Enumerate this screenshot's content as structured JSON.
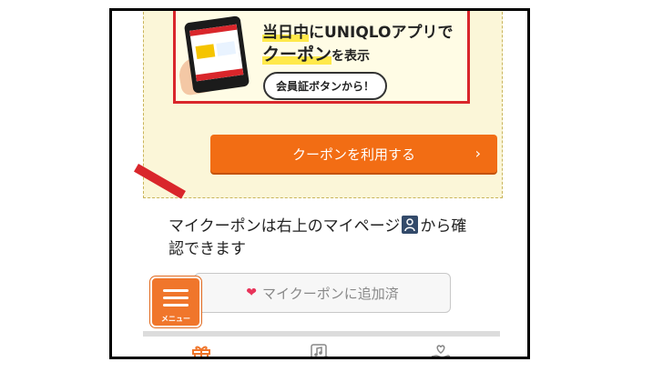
{
  "promo": {
    "line1_highlight": "当日中",
    "line1_rest": "にUNIQLOアプリで",
    "line2_highlight": "クーポン",
    "line2_rest": "を表示",
    "bubble": "会員証ボタンから！"
  },
  "use_button": {
    "label": "クーポンを利用する"
  },
  "info": {
    "text_before": "マイクーポンは右上のマイページ",
    "text_after": "から確認できます"
  },
  "added_button": {
    "label": "マイクーポンに追加済"
  },
  "menu": {
    "label": "メニュー"
  },
  "colors": {
    "accent": "#f26d14",
    "red": "#d9262b",
    "heart": "#e8345a",
    "tab_active": "#f0762b",
    "tab_inactive": "#888888"
  },
  "tabs": [
    {
      "icon": "gift-icon",
      "active": true
    },
    {
      "icon": "music-note-icon",
      "active": false
    },
    {
      "icon": "heart-hand-icon",
      "active": false
    }
  ]
}
